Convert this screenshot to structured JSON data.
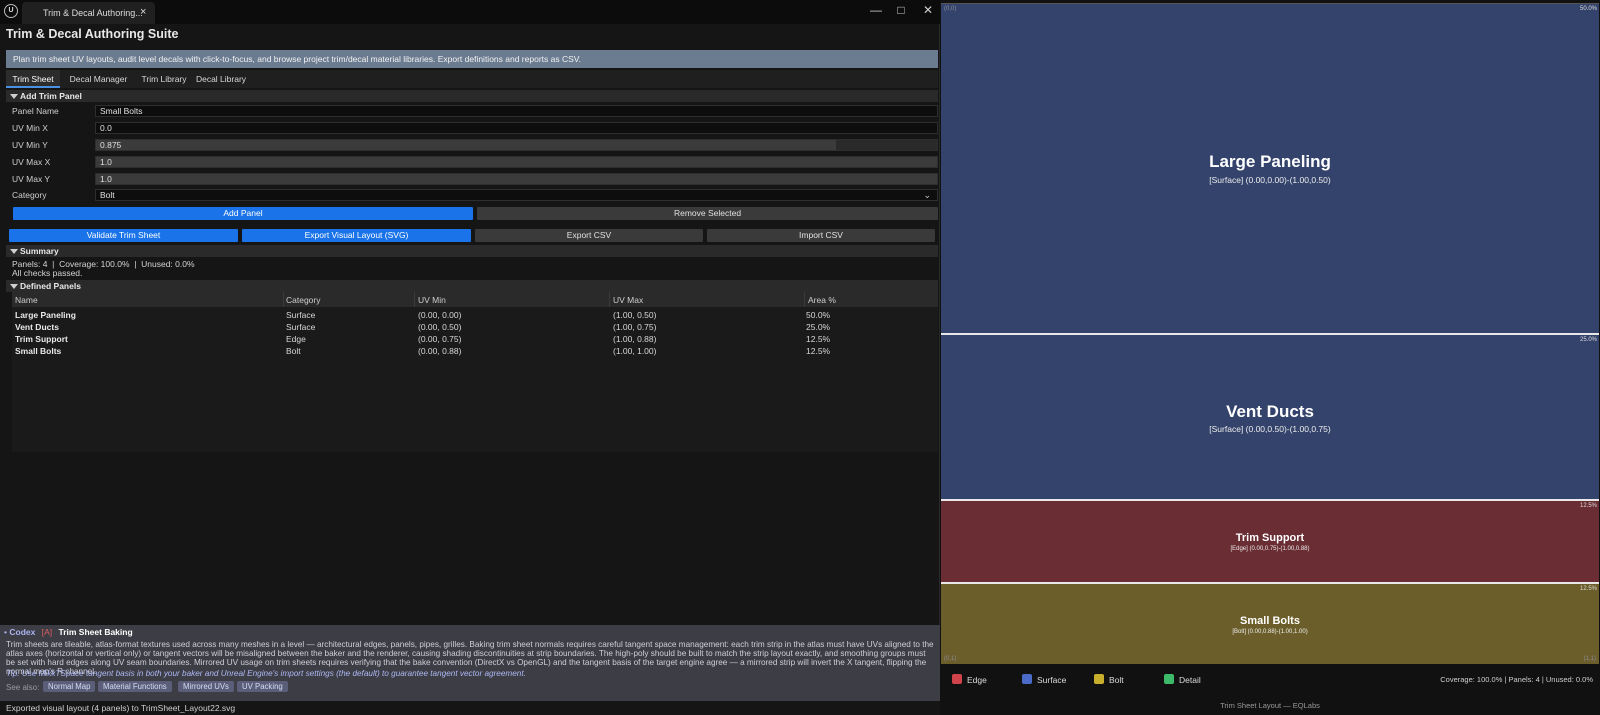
{
  "window": {
    "tab_title": "Trim & Decal Authoring...",
    "tab_close": "×",
    "minimize": "—",
    "maximize": "□",
    "close": "✕"
  },
  "app_title": "Trim & Decal Authoring Suite",
  "banner": "Plan trim sheet UV layouts, audit level decals with click-to-focus, and browse project trim/decal material libraries. Export definitions and reports as CSV.",
  "tabs": [
    "Trim Sheet",
    "Decal Manager",
    "Trim Library",
    "Decal Library"
  ],
  "active_tab": "Trim Sheet",
  "add_panel": {
    "header": "Add Trim Panel",
    "fields": [
      {
        "label": "Panel Name",
        "value": "Small Bolts"
      },
      {
        "label": "UV Min X",
        "value": "0.0"
      },
      {
        "label": "UV Min Y",
        "value": "0.875"
      },
      {
        "label": "UV Max X",
        "value": "1.0"
      },
      {
        "label": "UV Max Y",
        "value": "1.0"
      },
      {
        "label": "Category",
        "value": "Bolt"
      }
    ],
    "add_button": "Add Panel",
    "remove_button": "Remove Selected"
  },
  "actions": {
    "validate": "Validate Trim Sheet",
    "export_svg": "Export Visual Layout (SVG)",
    "export_csv": "Export CSV",
    "import_csv": "Import CSV"
  },
  "summary": {
    "header": "Summary",
    "line1": "Panels: 4  |  Coverage: 100.0%  |  Unused: 0.0%",
    "line2": "All checks passed."
  },
  "defined_panels": {
    "header": "Defined Panels",
    "columns": [
      "Name",
      "Category",
      "UV Min",
      "UV Max",
      "Area %"
    ],
    "rows": [
      [
        "Large Paneling",
        "Surface",
        "(0.00, 0.00)",
        "(1.00, 0.50)",
        "50.0%"
      ],
      [
        "Vent Ducts",
        "Surface",
        "(0.00, 0.50)",
        "(1.00, 0.75)",
        "25.0%"
      ],
      [
        "Trim Support",
        "Edge",
        "(0.00, 0.75)",
        "(1.00, 0.88)",
        "12.5%"
      ],
      [
        "Small Bolts",
        "Bolt",
        "(0.00, 0.88)",
        "(1.00, 1.00)",
        "12.5%"
      ]
    ]
  },
  "codex": {
    "prefix": "Codex",
    "tag": "[A]",
    "title": "Trim Sheet Baking",
    "body": "Trim sheets are tileable, atlas-format textures used across many meshes in a level — architectural edges, panels, pipes, grilles. Baking trim sheet normals requires careful tangent space management: each trim strip in the atlas must have UVs aligned to the atlas axes (horizontal or vertical only) or tangent vectors will be misaligned between the baker and the renderer, causing shading discontinuities at strip boundaries. The high-poly should be built to match the strip layout exactly, and smoothing groups must be set with hard edges along UV seam boundaries. Mirrored UV usage on trim sheets requires verifying that the bake convention (DirectX vs OpenGL) and the tangent basis of the target engine agree — a mirrored strip will invert the X tangent, flipping the normal map's R channel.",
    "tip": "Tip: Use MikkTSpace tangent basis in both your baker and Unreal Engine's import settings (the default) to guarantee tangent vector agreement.",
    "see_also_label": "See also:",
    "see_also": [
      "Normal Map",
      "Material Functions",
      "Mirrored UVs",
      "UV Packing"
    ]
  },
  "status": "Exported visual layout (4 panels) to TrimSheet_Layout22.svg",
  "layout_view": {
    "corner_top_left": "(0,0)",
    "corner_bottom_left": "(0,1)",
    "corner_bottom_right": "(1,1)",
    "panels": [
      {
        "name": "Large Paneling",
        "info": "[Surface] (0.00,0.00)-(1.00,0.50)",
        "pct": "50.0%",
        "color": "#34436b"
      },
      {
        "name": "Vent Ducts",
        "info": "[Surface] (0.00,0.50)-(1.00,0.75)",
        "pct": "25.0%",
        "color": "#34436b"
      },
      {
        "name": "Trim Support",
        "info": "[Edge] (0.00,0.75)-(1.00,0.88)",
        "pct": "12.5%",
        "color": "#6a2d33"
      },
      {
        "name": "Small Bolts",
        "info": "[Bolt] (0.00,0.88)-(1.00,1.00)",
        "pct": "12.5%",
        "color": "#6b5e2a"
      }
    ],
    "legend": [
      {
        "label": "Edge",
        "color": "#d0434b"
      },
      {
        "label": "Surface",
        "color": "#4a6bc8"
      },
      {
        "label": "Bolt",
        "color": "#c8ae2a"
      },
      {
        "label": "Detail",
        "color": "#3cba6a"
      }
    ],
    "stats": "Coverage: 100.0% | Panels: 4 | Unused: 0.0%",
    "footer": "Trim Sheet Layout — EQLabs"
  }
}
